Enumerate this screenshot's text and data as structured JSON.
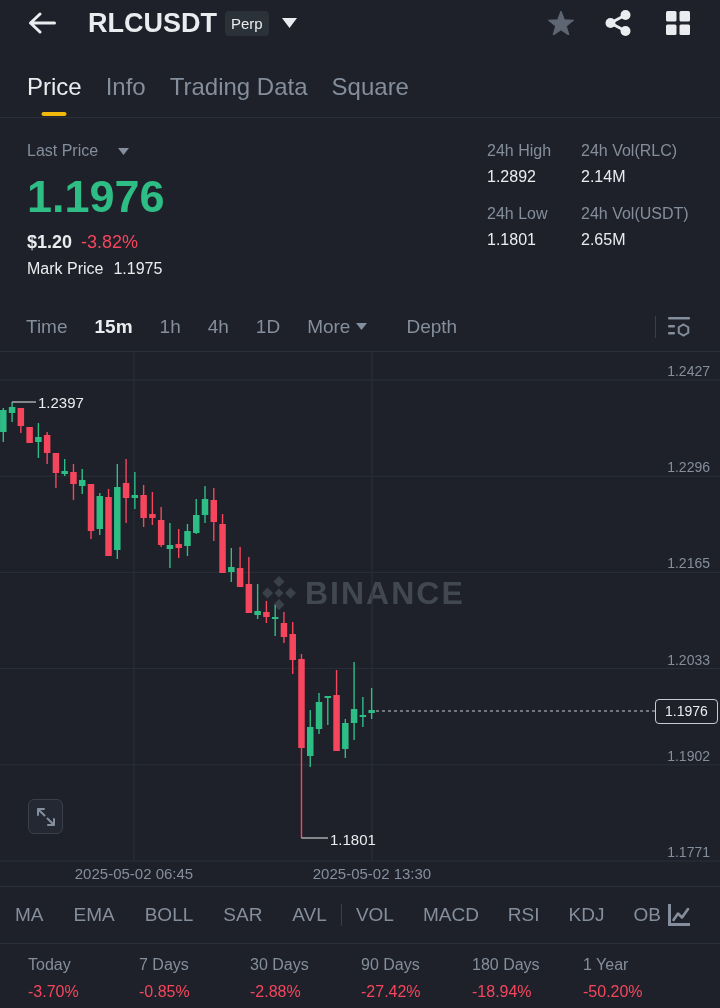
{
  "header": {
    "symbol": "RLCUSDT",
    "badge": "Perp",
    "favorite": false
  },
  "tabs": [
    {
      "label": "Price",
      "selected": true
    },
    {
      "label": "Info",
      "selected": false
    },
    {
      "label": "Trading Data",
      "selected": false
    },
    {
      "label": "Square",
      "selected": false
    }
  ],
  "ticker": {
    "label": "Last Price",
    "last_price": {
      "value": "1.1976",
      "rising": true
    },
    "fiat_price": "$1.20",
    "change": {
      "value": "-3.82%",
      "rising": false
    },
    "mark_price_label": "Mark Price",
    "mark_price": "1.1975"
  },
  "stats_24h": [
    {
      "label": "24h High",
      "value": "1.2892"
    },
    {
      "label": "24h Vol(RLC)",
      "value": "2.14M"
    },
    {
      "label": "24h Low",
      "value": "1.1801"
    },
    {
      "label": "24h Vol(USDT)",
      "value": "2.65M"
    }
  ],
  "intervals": [
    {
      "label": "Time",
      "kind": "tab",
      "selected": false
    },
    {
      "label": "15m",
      "kind": "tab",
      "selected": true
    },
    {
      "label": "1h",
      "kind": "tab",
      "selected": false
    },
    {
      "label": "4h",
      "kind": "tab",
      "selected": false
    },
    {
      "label": "1D",
      "kind": "tab",
      "selected": false
    },
    {
      "label": "More",
      "kind": "menu",
      "selected": false
    },
    {
      "label": "Depth",
      "kind": "tab",
      "selected": false
    }
  ],
  "chart": {
    "y_axis_labels": [
      "1.2427",
      "1.2296",
      "1.2165",
      "1.2033",
      "1.1902",
      "1.1771"
    ],
    "x_axis_labels": [
      "2025-05-02 06:45",
      "2025-05-02 13:30"
    ],
    "high_label": "1.2397",
    "low_label": "1.1801",
    "last_price_label": "1.1976",
    "watermark": "BINANCE"
  },
  "indicators": {
    "main": [
      "MA",
      "EMA",
      "BOLL",
      "SAR",
      "AVL"
    ],
    "sub": [
      "VOL",
      "MACD",
      "RSI",
      "KDJ",
      "OB"
    ]
  },
  "performance": [
    {
      "period": "Today",
      "value": "-3.70%",
      "rising": false
    },
    {
      "period": "7 Days",
      "value": "-0.85%",
      "rising": false
    },
    {
      "period": "30 Days",
      "value": "-2.88%",
      "rising": false
    },
    {
      "period": "90 Days",
      "value": "-27.42%",
      "rising": false
    },
    {
      "period": "180 Days",
      "value": "-18.94%",
      "rising": false
    },
    {
      "period": "1 Year",
      "value": "-50.20%",
      "rising": false
    }
  ]
}
